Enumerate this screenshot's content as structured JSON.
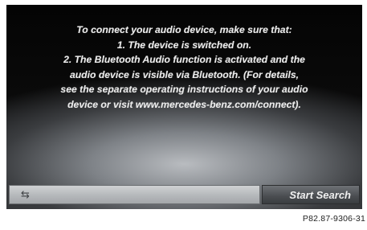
{
  "message": {
    "lines": [
      "To connect your audio device, make sure that:",
      "1. The device is switched on.",
      "2. The Bluetooth Audio function is activated and the",
      "audio device is visible via Bluetooth. (For details,",
      "see the separate operating instructions of your audio",
      "device or visit www.mercedes-benz.com/connect)."
    ]
  },
  "bottom_bar": {
    "back_icon": "back-arrow-icon",
    "back_glyph": "⇆",
    "start_search_label": "Start Search"
  },
  "figure_code": "P82.87-9306-31"
}
